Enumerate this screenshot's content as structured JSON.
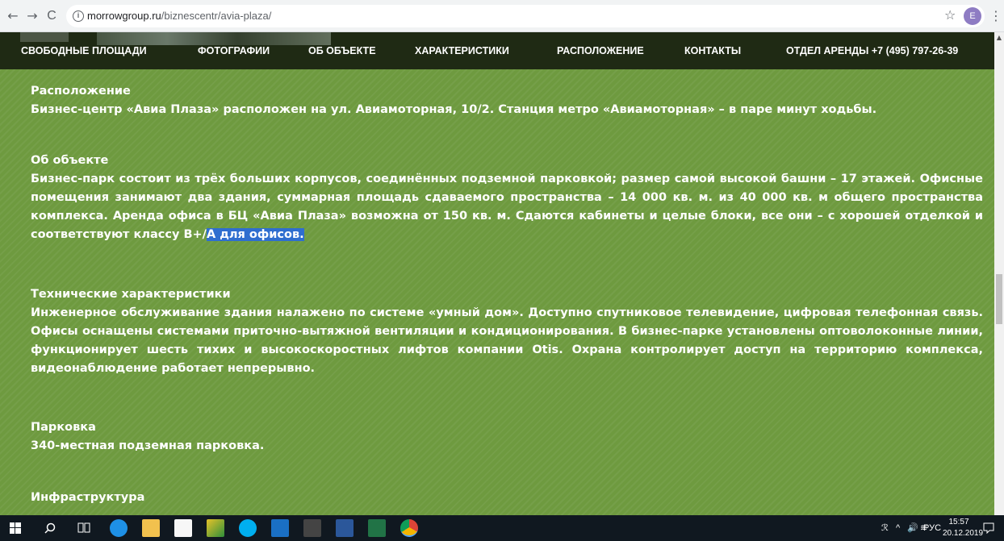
{
  "browser": {
    "back_glyph": "←",
    "forward_glyph": "→",
    "reload_glyph": "C",
    "url_domain": "morrowgroup.ru",
    "url_path": "/biznescentr/avia-plaza/",
    "profile_initial": "E",
    "star_glyph": "☆",
    "menu_glyph": "⋮"
  },
  "nav": {
    "items": [
      "СВОБОДНЫЕ ПЛОЩАДИ",
      "ФОТОГРАФИИ",
      "ОБ ОБЪЕКТЕ",
      "ХАРАКТЕРИСТИКИ",
      "РАСПОЛОЖЕНИЕ",
      "КОНТАКТЫ",
      "ОТДЕЛ АРЕНДЫ +7 (495) 797-26-39"
    ]
  },
  "content": {
    "location": {
      "heading": "Расположение",
      "body": "Бизнес-центр «Авиа Плаза» расположен на ул. Авиамоторная, 10/2. Станция метро «Авиамоторная» – в паре минут ходьбы."
    },
    "about": {
      "heading": "Об объекте",
      "body": "Бизнес-парк состоит из трёх больших корпусов, соединённых подземной парковкой; размер самой высокой башни – 17 этажей. Офисные помещения занимают два здания, суммарная площадь сдаваемого пространства – 14 000 кв. м. из 40 000 кв. м общего пространства комплекса. Аренда офиса в БЦ «Авиа Плаза» возможна от 150 кв. м. Сдаются кабинеты и целые блоки, все они – с хорошей отделкой и соответствуют классу B+/",
      "highlighted": "A для офисов."
    },
    "tech": {
      "heading": "Технические характеристики",
      "body": "Инженерное обслуживание здания налажено по системе «умный дом». Доступно спутниковое телевидение, цифровая телефонная связь. Офисы оснащены системами приточно-вытяжной вентиляции и кондиционирования. В бизнес-парке установлены оптоволоконные линии, функционирует шесть тихих и высокоскоростных лифтов компании Otis. Охрана контролирует доступ на территорию комплекса, видеонаблюдение работает непрерывно."
    },
    "parking": {
      "heading": "Парковка",
      "body": "340-местная подземная парковка."
    },
    "infra": {
      "heading": "Инфраструктура"
    }
  },
  "taskbar": {
    "lang": "РУС",
    "time": "15:57",
    "date": "20.12.2019"
  },
  "colors": {
    "content_bg": "#6e9a3f",
    "nav_bg": "#1f2a14",
    "highlight": "#2f6ecf"
  }
}
